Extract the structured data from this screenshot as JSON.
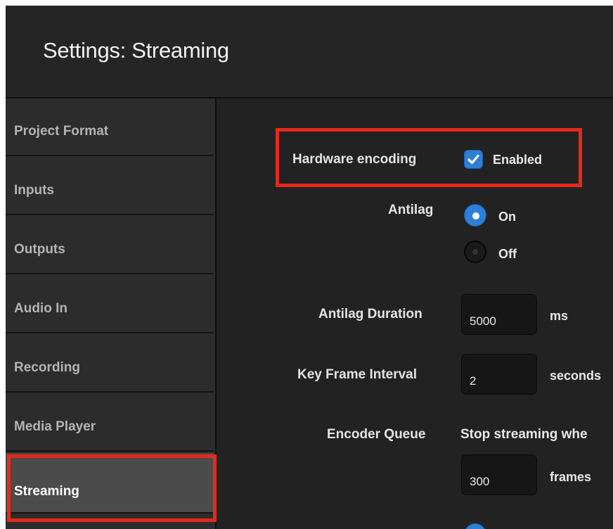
{
  "window": {
    "title": "Settings: Streaming"
  },
  "sidebar": {
    "items": [
      {
        "label": "Project Format"
      },
      {
        "label": "Inputs"
      },
      {
        "label": "Outputs"
      },
      {
        "label": "Audio In"
      },
      {
        "label": "Recording"
      },
      {
        "label": "Media Player"
      },
      {
        "label": "Streaming",
        "active": true
      }
    ]
  },
  "form": {
    "hardware_encoding": {
      "label": "Hardware encoding",
      "checkbox_label": "Enabled",
      "checked": true
    },
    "antilag": {
      "label": "Antilag",
      "options": [
        "On",
        "Off"
      ],
      "selected": "On"
    },
    "antilag_duration": {
      "label": "Antilag Duration",
      "value": "5000",
      "unit": "ms"
    },
    "key_frame_interval": {
      "label": "Key Frame Interval",
      "value": "2",
      "unit": "seconds"
    },
    "encoder_queue": {
      "label": "Encoder Queue",
      "description": "Stop streaming whe",
      "value": "300",
      "unit": "frames"
    }
  },
  "colors": {
    "accent": "#2d7fd8",
    "highlight": "#e8281a",
    "background": "#222222",
    "sidebar": "#2c2c2c"
  }
}
